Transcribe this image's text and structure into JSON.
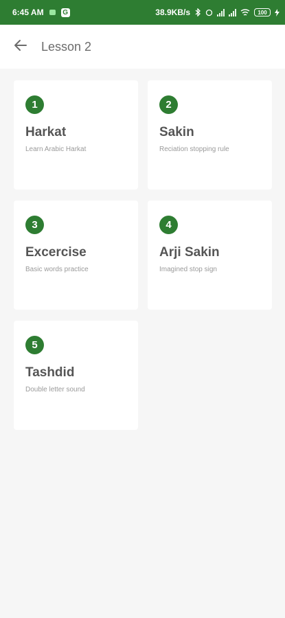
{
  "status_bar": {
    "time": "6:45 AM",
    "net_speed": "38.9KB/s",
    "battery": "100"
  },
  "app_bar": {
    "title": "Lesson 2"
  },
  "lessons": [
    {
      "number": "1",
      "title": "Harkat",
      "subtitle": "Learn Arabic Harkat"
    },
    {
      "number": "2",
      "title": "Sakin",
      "subtitle": "Reciation stopping rule"
    },
    {
      "number": "3",
      "title": "Excercise",
      "subtitle": "Basic words practice"
    },
    {
      "number": "4",
      "title": "Arji Sakin",
      "subtitle": "Imagined stop sign"
    },
    {
      "number": "5",
      "title": "Tashdid",
      "subtitle": "Double letter sound"
    }
  ],
  "colors": {
    "accent": "#2e7d32",
    "background": "#f6f6f6"
  },
  "icons": {
    "back": "arrow-back-icon"
  }
}
